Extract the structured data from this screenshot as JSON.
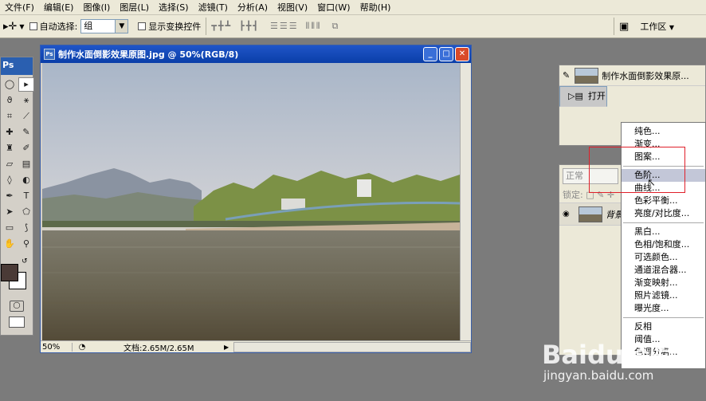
{
  "menubar": {
    "items": [
      "文件(F)",
      "编辑(E)",
      "图像(I)",
      "图层(L)",
      "选择(S)",
      "滤镜(T)",
      "分析(A)",
      "视图(V)",
      "窗口(W)",
      "帮助(H)"
    ]
  },
  "options": {
    "auto_select_label": "自动选择:",
    "auto_select_value": "组",
    "show_transform_label": "显示变换控件",
    "workspace_label": "工作区"
  },
  "toolbox": {
    "badge": "Ps"
  },
  "document": {
    "title": "制作水面倒影效果原图.jpg @ 50%(RGB/8)",
    "zoom": "50%",
    "doc_info": "文档:2.65M/2.65M"
  },
  "history": {
    "items": [
      {
        "label": "制作水面倒影效果原..."
      },
      {
        "label": "打开"
      }
    ]
  },
  "layers": {
    "blend_mode": "正常",
    "lock_label": "锁定:",
    "layer_name": "背景"
  },
  "context_menu": {
    "groups": [
      [
        "纯色...",
        "渐变...",
        "图案..."
      ],
      [
        "色阶...",
        "曲线...",
        "色彩平衡...",
        "亮度/对比度..."
      ],
      [
        "黑白...",
        "色相/饱和度...",
        "可选颜色...",
        "通道混合器...",
        "渐变映射...",
        "照片滤镜...",
        "曝光度..."
      ],
      [
        "反相",
        "阈值...",
        "色调分离..."
      ]
    ],
    "highlighted": "色阶..."
  },
  "watermark": {
    "logo": "Baidu经验",
    "url": "jingyan.baidu.com"
  },
  "colors": {
    "foreground": "#4a3a36",
    "background": "#ffffff",
    "title_blue": "#0a3ea8",
    "highlight_box": "#e0202a"
  }
}
